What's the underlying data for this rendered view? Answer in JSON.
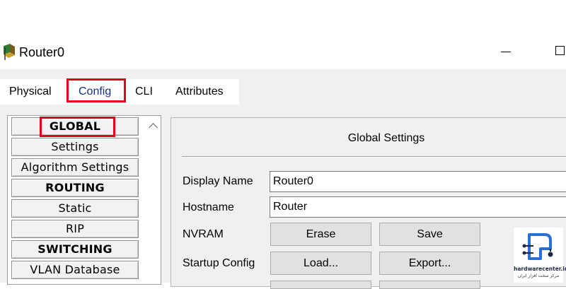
{
  "window": {
    "title": "Router0"
  },
  "tabs": [
    {
      "label": "Physical"
    },
    {
      "label": "Config"
    },
    {
      "label": "CLI"
    },
    {
      "label": "Attributes"
    }
  ],
  "sidebar": {
    "items": [
      {
        "label": "GLOBAL"
      },
      {
        "label": "Settings"
      },
      {
        "label": "Algorithm Settings"
      },
      {
        "label": "ROUTING"
      },
      {
        "label": "Static"
      },
      {
        "label": "RIP"
      },
      {
        "label": "SWITCHING"
      },
      {
        "label": "VLAN Database"
      }
    ]
  },
  "settings": {
    "title": "Global Settings",
    "display_name_label": "Display Name",
    "display_name_value": "Router0",
    "hostname_label": "Hostname",
    "hostname_value": "Router",
    "nvram_label": "NVRAM",
    "erase_label": "Erase",
    "save_label": "Save",
    "startup_config_label": "Startup Config",
    "load_label": "Load...",
    "export_label": "Export..."
  },
  "watermark": {
    "brand": "hardwarecenter.ir",
    "tagline": "مرکز سخت افزار ایران"
  },
  "colors": {
    "highlight": "#e0001b",
    "panel_background": "#f0f0f0",
    "active_tab_text": "#1a2f7a"
  }
}
